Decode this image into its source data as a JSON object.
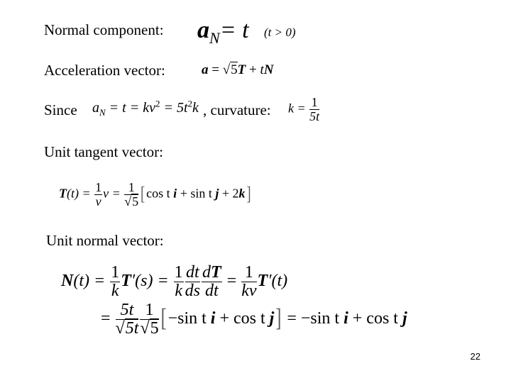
{
  "slide": {
    "labels": {
      "normal_component": "Normal component:",
      "acceleration_vector": "Acceleration vector:",
      "since": "Since",
      "curvature": ", curvature:",
      "unit_tangent": "Unit tangent vector:",
      "unit_normal": "Unit normal vector:"
    },
    "equations": {
      "normal_component": {
        "lhs": "a",
        "lhs_sub": "N",
        "rhs": "= t",
        "condition": "(t > 0)"
      },
      "acceleration": {
        "a": "a",
        "eq": " = ",
        "sqrt": "5",
        "T": "T",
        "plus": " + ",
        "t": "t",
        "N": "N"
      },
      "since": {
        "a": "a",
        "sub": "N",
        "mid": " = t = kv",
        "sup1": "2",
        "mid2": " = 5t",
        "sup2": "2",
        "end": "k"
      },
      "curvature": {
        "k": "k = ",
        "num": "1",
        "den": "5t"
      },
      "tangent": {
        "T": "T",
        "arg": "(t) = ",
        "num1": "1",
        "den1": "v",
        "v": "v = ",
        "num2": "1",
        "den2_sqrt": "5",
        "body_cos": "cos t ",
        "i": "i",
        "plus1": " + sin t ",
        "j": "j",
        "plus2": " + 2",
        "k": "k"
      },
      "normal_line1": {
        "N": "N",
        "arg": "(t) = ",
        "f1_num": "1",
        "f1_den": "k",
        "Tp": "T",
        "Tp_arg": "′(s) = ",
        "f2_num": "1",
        "f2_den": "k",
        "f3_num": "dt",
        "f3_den": "ds",
        "f4_num_d": "d",
        "f4_num_T": "T",
        "f4_den": "dt",
        "eq": " = ",
        "f5_num": "1",
        "f5_den": "kv",
        "Tp2": "T",
        "Tp2_arg": "′(t)"
      },
      "normal_line2": {
        "eq": "= ",
        "f1_num": "5t",
        "f1_den_sqrt": "5t",
        "f2_num": "1",
        "f2_den_sqrt": "5",
        "inner1": "−sin t ",
        "i": "i",
        "inner2": " + cos t ",
        "j": "j",
        "result1": " = −sin t ",
        "i2": "i",
        "result2": " + cos t ",
        "j2": "j"
      }
    },
    "page_number": "22"
  }
}
